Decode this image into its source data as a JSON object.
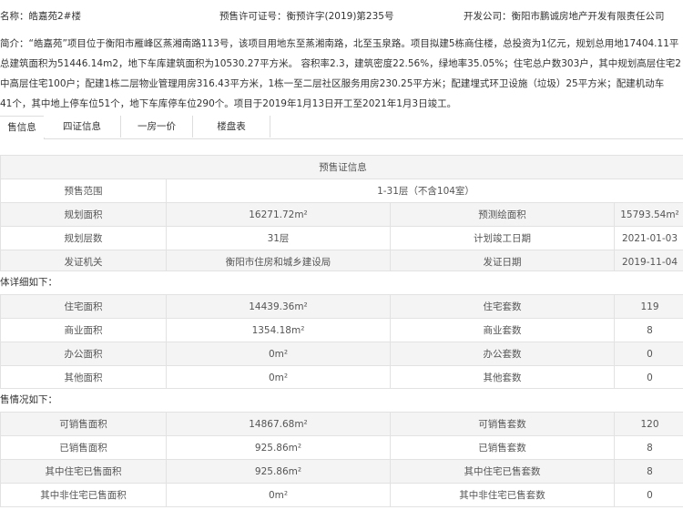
{
  "header": {
    "building_name": "名称：皓嘉苑2#楼",
    "permit": "预售许可证号：衡预许字(2019)第235号",
    "developer": "开发公司：衡阳市鹏诚房地产开发有限责任公司"
  },
  "intro": {
    "line1": "简介：“皓嘉苑”项目位于衡阳市雁峰区蒸湘南路113号，该项目用地东至蒸湘南路，北至玉泉路。项目拟建5栋商住楼，总投资为1亿元，规划总用地17404.11平",
    "line2": "总建筑面积为51446.14m2，地下车库建筑面积为10530.27平方米。 容积率2.3，建筑密度22.56%，绿地率35.05%；住宅总户数303户，其中规划高层住宅2",
    "line3": "中高层住宅100户；配建1栋二层物业管理用房316.43平方米，1栋一至二层社区服务用房230.25平方米；配建埋式环卫设施（垃圾）25平方米；配建机动车",
    "line4": "41个，其中地上停车位51个，地下车库停车位290个。项目于2019年1月13日开工至2021年1月3日竣工。"
  },
  "tabs": [
    "售信息",
    "四证信息",
    "一房一价",
    "楼盘表"
  ],
  "presale": {
    "caption": "预售证信息",
    "range_label": "预售范围",
    "range_value": "1-31层（不含104室）",
    "rows": [
      [
        "规划面积",
        "16271.72m²",
        "预测绘面积",
        "15793.54m²"
      ],
      [
        "规划层数",
        "31层",
        "计划竣工日期",
        "2021-01-03"
      ],
      [
        "发证机关",
        "衡阳市住房和城乡建设局",
        "发证日期",
        "2019-11-04"
      ]
    ]
  },
  "detail": {
    "label": "体详细如下：",
    "rows": [
      [
        "住宅面积",
        "14439.36m²",
        "住宅套数",
        "119"
      ],
      [
        "商业面积",
        "1354.18m²",
        "商业套数",
        "8"
      ],
      [
        "办公面积",
        "0m²",
        "办公套数",
        "0"
      ],
      [
        "其他面积",
        "0m²",
        "其他套数",
        "0"
      ]
    ]
  },
  "sales": {
    "label": "售情况如下：",
    "rows": [
      [
        "可销售面积",
        "14867.68m²",
        "可销售套数",
        "120"
      ],
      [
        "已销售面积",
        "925.86m²",
        "已销售套数",
        "8"
      ],
      [
        "其中住宅已售面积",
        "925.86m²",
        "其中住宅已售套数",
        "8"
      ],
      [
        "其中非住宅已售面积",
        "0m²",
        "其中非住宅已售套数",
        "0"
      ]
    ]
  }
}
